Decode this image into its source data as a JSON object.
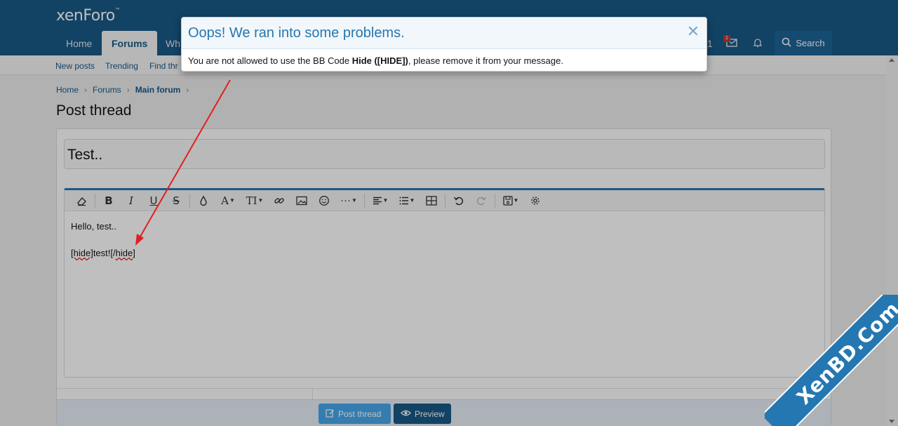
{
  "header": {
    "logo": "xenForo",
    "tabs": [
      {
        "label": "Home"
      },
      {
        "label": "Forums"
      },
      {
        "label": "Wh"
      }
    ],
    "right_number": "1",
    "badge_count": "1",
    "search_label": "Search"
  },
  "subnav": {
    "items": [
      {
        "label": "New posts"
      },
      {
        "label": "Trending"
      },
      {
        "label": "Find thr"
      }
    ]
  },
  "breadcrumb": {
    "items": [
      {
        "label": "Home"
      },
      {
        "label": "Forums"
      },
      {
        "label": "Main forum"
      }
    ]
  },
  "page": {
    "title": "Post thread"
  },
  "form": {
    "thread_title": "Test..",
    "editor_line1": "Hello, test..",
    "editor_line2_a": "[hide]",
    "editor_line2_b": "test![/",
    "editor_line2_c": "hide",
    "editor_line2_d": "]",
    "post_button": "Post thread",
    "preview_button": "Preview"
  },
  "modal": {
    "title": "Oops! We ran into some problems.",
    "message_before": "You are not allowed to use the BB Code ",
    "message_bold": "Hide ([HIDE])",
    "message_after": ", please remove it from your message."
  },
  "watermark": "XenBD.Com",
  "colors": {
    "header_bg": "#185886",
    "accent": "#2577b1",
    "annotation_arrow": "#e02020"
  }
}
